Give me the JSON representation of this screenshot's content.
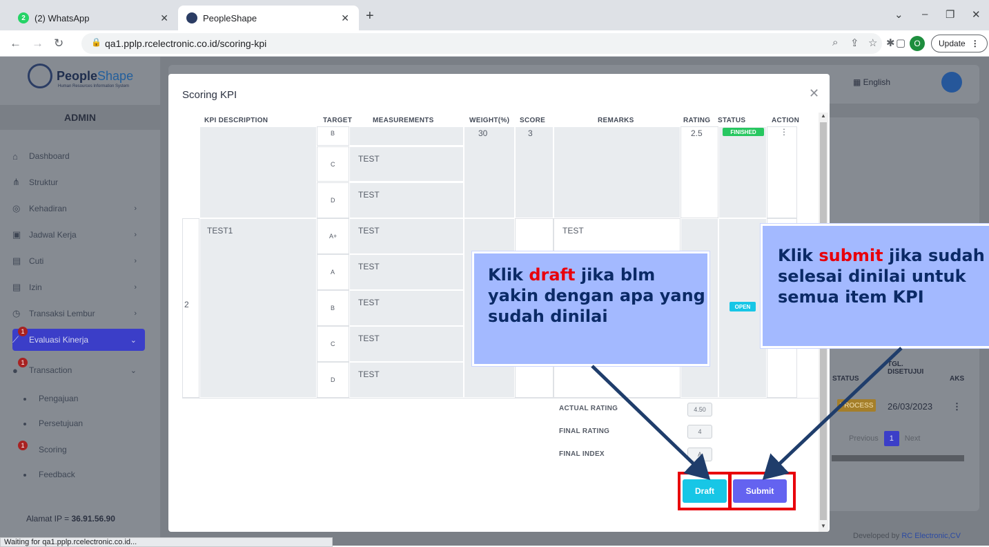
{
  "browser": {
    "tabs": [
      {
        "label": "(2) WhatsApp",
        "badge": "2"
      },
      {
        "label": "PeopleShape"
      }
    ],
    "url": "qa1.pplp.rcelectronic.co.id/scoring-kpi",
    "profile_initial": "O",
    "update_label": "Update",
    "status_text": "Waiting for qa1.pplp.rcelectronic.co.id..."
  },
  "app": {
    "logo": {
      "name_main": "People",
      "name_accent": "Shape",
      "tagline": "Human Resources Information System"
    },
    "role": "ADMIN",
    "language": "English",
    "menu": [
      {
        "label": "Dashboard",
        "icon": "home-icon"
      },
      {
        "label": "Struktur",
        "icon": "structure-icon"
      },
      {
        "label": "Kehadiran",
        "icon": "fingerprint-icon"
      },
      {
        "label": "Jadwal Kerja",
        "icon": "calendar-icon"
      },
      {
        "label": "Cuti",
        "icon": "calendar-icon"
      },
      {
        "label": "Izin",
        "icon": "calendar-icon"
      },
      {
        "label": "Transaksi Lembur",
        "icon": "clock-icon"
      },
      {
        "label": "Evaluasi Kinerja",
        "icon": "chart-icon",
        "badge": "1"
      },
      {
        "label": "Transaction",
        "badge": "1"
      }
    ],
    "submenu": [
      {
        "label": "Pengajuan"
      },
      {
        "label": "Persetujuan"
      },
      {
        "label": "Scoring",
        "badge": "1"
      },
      {
        "label": "Feedback"
      }
    ],
    "ip_label": "Alamat IP  =",
    "ip_value": "36.91.56.90",
    "right_panel": {
      "col_status": "STATUS",
      "col_date": "TGL.\nDISETUJUI",
      "col_action": "AKS",
      "status_value": "PROCESS",
      "date_value": "26/03/2023",
      "pager": {
        "prev": "Previous",
        "page": "1",
        "next": "Next"
      }
    },
    "footer": {
      "prefix": "Developed by",
      "company": "RC Electronic,CV"
    }
  },
  "modal": {
    "title": "Scoring KPI",
    "columns": [
      "KPI DESCRIPTION",
      "TARGET",
      "MEASUREMENTS",
      "WEIGHT(%)",
      "SCORE",
      "REMARKS",
      "RATING",
      "STATUS",
      "ACTION"
    ],
    "group1": {
      "partial_values": {
        "target": "B",
        "weight": "30",
        "score": "3",
        "rating": "2.5",
        "status": "FINISHED",
        "action": "⋮"
      },
      "rows": [
        {
          "target": "C",
          "measurement": "TEST"
        },
        {
          "target": "D",
          "measurement": "TEST"
        }
      ]
    },
    "group2": {
      "no": "2",
      "description": "TEST1",
      "remarks": "TEST",
      "status": "OPEN",
      "rows": [
        {
          "target": "A+",
          "measurement": "TEST"
        },
        {
          "target": "A",
          "measurement": "TEST"
        },
        {
          "target": "B",
          "measurement": "TEST"
        },
        {
          "target": "C",
          "measurement": "TEST"
        },
        {
          "target": "D",
          "measurement": "TEST"
        }
      ]
    },
    "summary": [
      {
        "label": "ACTUAL RATING",
        "value": "4.50"
      },
      {
        "label": "FINAL RATING",
        "value": "4"
      },
      {
        "label": "FINAL INDEX",
        "value": "A"
      }
    ],
    "buttons": {
      "draft": "Draft",
      "submit": "Submit"
    }
  },
  "callouts": {
    "draft": {
      "prefix": "Klik ",
      "keyword": "draft",
      "rest": " jika blm yakin dengan apa yang sudah dinilai"
    },
    "submit": {
      "prefix": "Klik ",
      "keyword": "submit",
      "rest": " jika sudah selesai dinilai untuk semua item KPI"
    }
  },
  "colors": {
    "highlight": "#e8000b",
    "arrow": "#1f3d6b",
    "callout_bg": "#a3b9ff",
    "draft_button": "#17c6e6",
    "submit_button": "#6463f0"
  }
}
